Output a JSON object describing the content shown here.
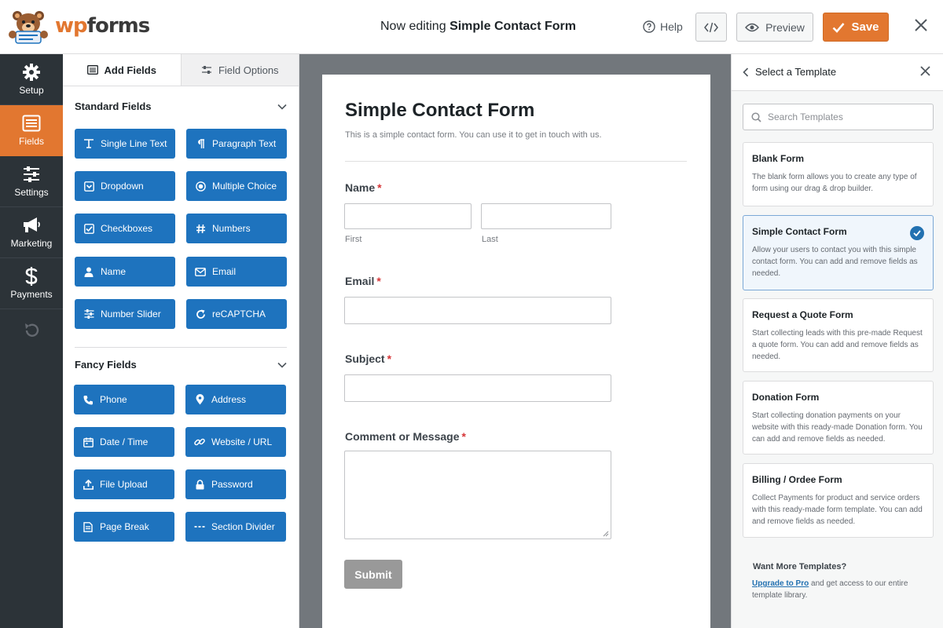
{
  "header": {
    "logo_wp": "wp",
    "logo_forms": "forms",
    "editing_prefix": "Now editing",
    "form_name": "Simple Contact Form",
    "help_label": "Help",
    "embed_icon": "code-icon",
    "preview_label": "Preview",
    "save_label": "Save",
    "close_icon": "close-icon"
  },
  "colors": {
    "accent": "#e27730",
    "field_button": "#1e73be",
    "nav_bg": "#2c3338",
    "selected_check": "#2271b1"
  },
  "nav": {
    "items": [
      {
        "label": "Setup",
        "icon": "gear-icon"
      },
      {
        "label": "Fields",
        "icon": "list-icon",
        "active": true
      },
      {
        "label": "Settings",
        "icon": "sliders-icon"
      },
      {
        "label": "Marketing",
        "icon": "megaphone-icon"
      },
      {
        "label": "Payments",
        "icon": "dollar-icon"
      }
    ],
    "undo_icon": "undo-icon"
  },
  "panel": {
    "tabs": [
      {
        "label": "Add Fields",
        "icon": "list-icon",
        "active": true
      },
      {
        "label": "Field Options",
        "icon": "sliders-icon"
      }
    ],
    "standard_title": "Standard Fields",
    "standard_fields": [
      "Single Line Text",
      "Paragraph Text",
      "Dropdown",
      "Multiple Choice",
      "Checkboxes",
      "Numbers",
      "Name",
      "Email",
      "Number Slider",
      "reCAPTCHA"
    ],
    "fancy_title": "Fancy Fields",
    "fancy_fields": [
      "Phone",
      "Address",
      "Date / Time",
      "Website / URL",
      "File Upload",
      "Password",
      "Page Break",
      "Section Divider"
    ]
  },
  "form": {
    "title": "Simple Contact Form",
    "description": "This is a simple contact form. You can use it to get in touch with us.",
    "name_label": "Name",
    "first_label": "First",
    "last_label": "Last",
    "email_label": "Email",
    "subject_label": "Subject",
    "message_label": "Comment or Message",
    "required_mark": "*",
    "submit_label": "Submit"
  },
  "templates": {
    "title": "Select a Template",
    "search_placeholder": "Search Templates",
    "items": [
      {
        "name": "Blank Form",
        "desc": "The blank form allows you to create any type of form using our drag & drop builder."
      },
      {
        "name": "Simple Contact Form",
        "desc": "Allow your users to contact you with this simple contact form. You can add and remove fields as needed.",
        "selected": true
      },
      {
        "name": "Request a Quote Form",
        "desc": "Start collecting leads with this pre-made Request a quote form. You can add and remove fields as needed."
      },
      {
        "name": "Donation Form",
        "desc": "Start collecting donation payments on your website with this ready-made Donation form. You can add and remove fields as needed."
      },
      {
        "name": "Billing / Ordee Form",
        "desc": "Collect Payments for product and service orders with this ready-made form template. You can add and remove fields as needed."
      }
    ],
    "more_title": "Want More Templates?",
    "upgrade_link": "Upgrade to Pro",
    "more_desc": "and get access to our entire template library."
  }
}
